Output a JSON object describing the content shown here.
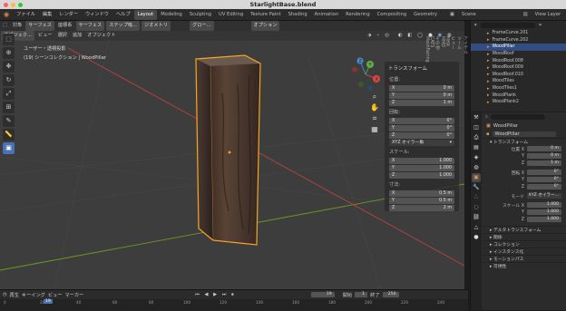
{
  "window": {
    "title": "StarlightBase.blend"
  },
  "menu": {
    "items": [
      "ファイル",
      "編集",
      "レンダー",
      "ウィンドウ",
      "ヘルプ"
    ]
  },
  "workspaces": {
    "tabs": [
      "Layout",
      "Modeling",
      "Sculpting",
      "UV Editing",
      "Texture Paint",
      "Shading",
      "Animation",
      "Rendering",
      "Compositing",
      "Geometry"
    ],
    "active": "Layout"
  },
  "scene": {
    "name": "Scene"
  },
  "view_layer": {
    "name": "View Layer"
  },
  "viewport": {
    "header": {
      "mode": "オブジェク...",
      "items": [
        "ビュー",
        "選択",
        "追加",
        "オブジェクト"
      ]
    },
    "topbar": {
      "items": [
        "対象",
        "サーフェス",
        "座標系",
        "サーフェス",
        "ステップ吸...",
        "ジオメトリ",
        "グロー..."
      ],
      "options": "オプション"
    },
    "overlay_lines": [
      "ユーザー・透視投影",
      "(19) シーンコレクション | WoodPillar"
    ],
    "gizmo": {
      "x": "X",
      "y": "Y",
      "z": "Z"
    }
  },
  "tools": [
    "select",
    "cursor",
    "move",
    "rotate",
    "scale",
    "transform",
    "annotate",
    "measure",
    "add-cube"
  ],
  "npanel": {
    "title": "トランスフォーム",
    "location_label": "位置:",
    "location": [
      {
        "axis": "X",
        "value": "0 m"
      },
      {
        "axis": "Y",
        "value": "0 m"
      },
      {
        "axis": "Z",
        "value": "1 m"
      }
    ],
    "rotation_label": "回転:",
    "rotation": [
      {
        "axis": "X",
        "value": "0°"
      },
      {
        "axis": "Y",
        "value": "0°"
      },
      {
        "axis": "Z",
        "value": "0°"
      }
    ],
    "rotation_mode": "XYZ オイラー角",
    "scale_label": "スケール:",
    "scale": [
      {
        "axis": "X",
        "value": "1.000"
      },
      {
        "axis": "Y",
        "value": "1.000"
      },
      {
        "axis": "Z",
        "value": "1.000"
      }
    ],
    "dimensions_label": "寸法:",
    "dimensions": [
      {
        "axis": "X",
        "value": "0.5 m"
      },
      {
        "axis": "Y",
        "value": "0.5 m"
      },
      {
        "axis": "Z",
        "value": "2 m"
      }
    ]
  },
  "side_tabs": [
    "アイテム",
    "ツール",
    "ビュー",
    "MHX",
    "MMD",
    "その他",
    "CATS",
    "MeshFairing"
  ],
  "outliner": {
    "rows": [
      {
        "name": "FrameCurve.201"
      },
      {
        "name": "FrameCurve.202"
      },
      {
        "name": "WoodPillar",
        "selected": true
      },
      {
        "name": "WoodRoof"
      },
      {
        "name": "WoodRoof.008"
      },
      {
        "name": "WoodRoof.009"
      },
      {
        "name": "WoodRoof.010"
      },
      {
        "name": "WoodTiles"
      },
      {
        "name": "WoodTiles1"
      },
      {
        "name": "WoodPlank"
      },
      {
        "name": "WoodPlank2"
      }
    ]
  },
  "properties": {
    "object_name": "WoodPillar",
    "data_name": "WoodPillar",
    "transform_header": "トランスフォーム",
    "location_label": "位置 X",
    "location": [
      "0 m",
      "0 m",
      "1 m"
    ],
    "rotation_label": "回転 X",
    "rotation": [
      "0°",
      "0°",
      "0°"
    ],
    "mode_label": "モード",
    "mode_value": "XYZ オイラー...",
    "scale_label": "スケール X",
    "scale": [
      "1.000",
      "1.000",
      "1.000"
    ],
    "axis_labels": [
      "Y",
      "Z"
    ],
    "sections": [
      "デルタトランスフォーム",
      "関係",
      "コレクション",
      "インスタンス化",
      "モーションパス",
      "可視性"
    ]
  },
  "timeline": {
    "items": [
      "再生",
      "キーイング",
      "ビュー",
      "マーカー"
    ],
    "current_frame": "19",
    "start_label": "開始",
    "start": "1",
    "end_label": "終了",
    "end": "250",
    "ticks": [
      "0",
      "20",
      "40",
      "60",
      "80",
      "100",
      "120",
      "140",
      "160",
      "180",
      "200",
      "220",
      "240"
    ],
    "playhead": "19"
  },
  "colors": {
    "accent": "#4772b3",
    "selection_outline": "#f5a623",
    "x_axis": "#b84242",
    "y_axis": "#6b9a26"
  }
}
